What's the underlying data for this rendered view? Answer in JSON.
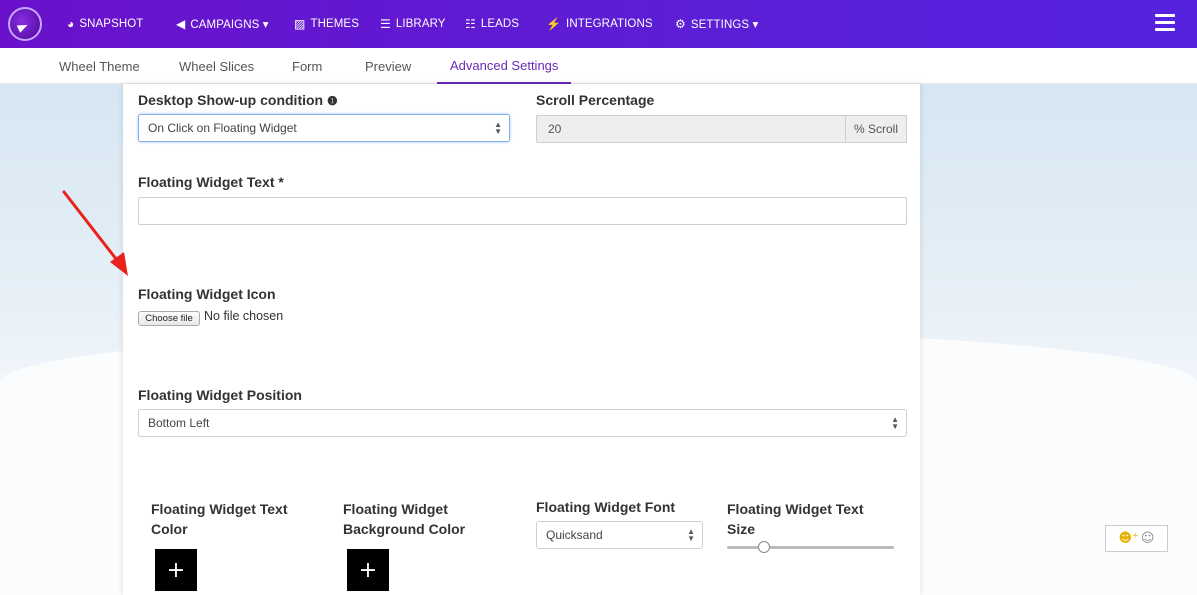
{
  "nav": {
    "items": [
      {
        "icon": "dashboard-icon",
        "glyph": "◕",
        "label": "SNAPSHOT"
      },
      {
        "icon": "paper-plane-icon",
        "glyph": "◀",
        "label": "CAMPAIGNS ▾"
      },
      {
        "icon": "image-icon",
        "glyph": "▨",
        "label": "THEMES"
      },
      {
        "icon": "book-icon",
        "glyph": "☰",
        "label": "LIBRARY"
      },
      {
        "icon": "list-icon",
        "glyph": "☷",
        "label": "LEADS"
      },
      {
        "icon": "plug-icon",
        "glyph": "⚡",
        "label": "INTEGRATIONS"
      },
      {
        "icon": "cogs-icon",
        "glyph": "⚙",
        "label": "SETTINGS ▾"
      }
    ]
  },
  "subtabs": [
    "Wheel Theme",
    "Wheel Slices",
    "Form",
    "Preview",
    "Advanced Settings"
  ],
  "active_subtab": "Advanced Settings",
  "form": {
    "desktop_condition_label": "Desktop Show-up condition",
    "desktop_condition_info": "❶",
    "desktop_condition_value": "On Click on Floating Widget",
    "scroll_label": "Scroll Percentage",
    "scroll_value": "20",
    "scroll_addon": "% Scroll",
    "widget_text_label": "Floating Widget Text *",
    "widget_text_value": "",
    "widget_icon_label": "Floating Widget Icon",
    "choose_file": "Choose file",
    "no_file": "No file chosen",
    "position_label": "Floating Widget Position",
    "position_value": "Bottom Left",
    "text_color_label_1": "Floating Widget Text",
    "text_color_label_2": "Color",
    "bg_color_label_1": "Floating Widget",
    "bg_color_label_2": "Background Color",
    "font_label": "Floating Widget Font",
    "font_value": "Quicksand",
    "text_size_label_1": "Floating Widget Text",
    "text_size_label_2": "Size",
    "text_size_level": 0.22,
    "plus": "+"
  },
  "colors": {
    "nav_bg": "#5b1fd6",
    "active_tab": "#6a2bb8",
    "arrow": "#e8221b"
  }
}
